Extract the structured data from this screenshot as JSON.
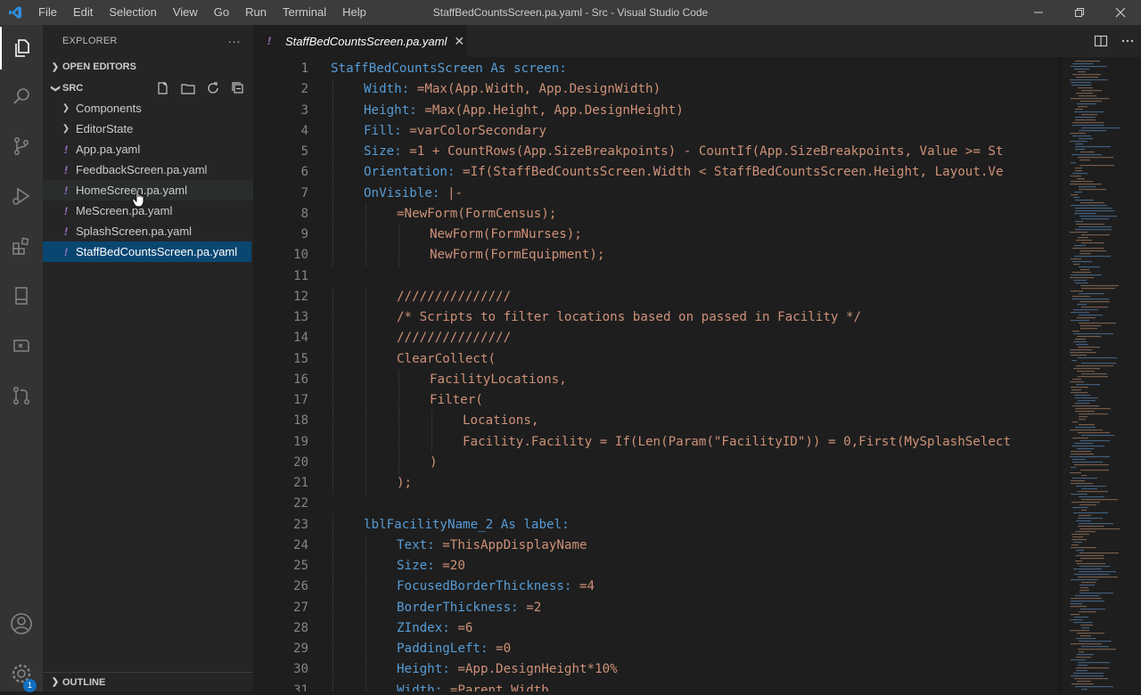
{
  "window": {
    "title": "StaffBedCountsScreen.pa.yaml - Src - Visual Studio Code",
    "menu": [
      "File",
      "Edit",
      "Selection",
      "View",
      "Go",
      "Run",
      "Terminal",
      "Help"
    ]
  },
  "activity_bar": {
    "items": [
      "files-icon",
      "search-icon",
      "source-control-icon",
      "run-debug-icon",
      "extensions-icon",
      "book-icon",
      "remote-icon",
      "pull-request-icon"
    ],
    "bottom": [
      "account-icon",
      "manage-gear-icon"
    ],
    "badge": "1"
  },
  "sidebar": {
    "title": "EXPLORER",
    "more": "···",
    "open_editors": "OPEN EDITORS",
    "folder": "SRC",
    "items": [
      {
        "type": "folder",
        "label": "Components"
      },
      {
        "type": "folder",
        "label": "EditorState"
      },
      {
        "type": "file",
        "label": "App.pa.yaml"
      },
      {
        "type": "file",
        "label": "FeedbackScreen.pa.yaml"
      },
      {
        "type": "file",
        "label": "HomeScreen.pa.yaml"
      },
      {
        "type": "file",
        "label": "MeScreen.pa.yaml"
      },
      {
        "type": "file",
        "label": "SplashScreen.pa.yaml"
      },
      {
        "type": "file",
        "label": "StaffBedCountsScreen.pa.yaml"
      }
    ],
    "outline": "OUTLINE",
    "yaml_glyph": "!"
  },
  "tab": {
    "name": "StaffBedCountsScreen.pa.yaml",
    "close": "✕"
  },
  "code": {
    "line_numbers": [
      "1",
      "2",
      "3",
      "4",
      "5",
      "6",
      "7",
      "8",
      "9",
      "10",
      "11",
      "12",
      "13",
      "14",
      "15",
      "16",
      "17",
      "18",
      "19",
      "20",
      "21",
      "22",
      "23",
      "24",
      "25",
      "26",
      "27",
      "28",
      "29",
      "30",
      "31"
    ],
    "lines": [
      {
        "indent": 0,
        "key": "StaffBedCountsScreen As screen:",
        "value": ""
      },
      {
        "indent": 1,
        "key": "Width:",
        "value": " =Max(App.Width, App.DesignWidth)"
      },
      {
        "indent": 1,
        "key": "Height:",
        "value": " =Max(App.Height, App.DesignHeight)"
      },
      {
        "indent": 1,
        "key": "Fill:",
        "value": " =varColorSecondary"
      },
      {
        "indent": 1,
        "key": "Size:",
        "value": " =1 + CountRows(App.SizeBreakpoints) - CountIf(App.SizeBreakpoints, Value >= St"
      },
      {
        "indent": 1,
        "key": "Orientation:",
        "value": " =If(StaffBedCountsScreen.Width < StaffBedCountsScreen.Height, Layout.Ve"
      },
      {
        "indent": 1,
        "key": "OnVisible:",
        "value": " |-"
      },
      {
        "indent": 2,
        "key": "",
        "value": "=NewForm(FormCensus);"
      },
      {
        "indent": 3,
        "key": "",
        "value": "NewForm(FormNurses);"
      },
      {
        "indent": 3,
        "key": "",
        "value": "NewForm(FormEquipment);"
      },
      {
        "indent": 0,
        "key": "",
        "value": ""
      },
      {
        "indent": 2,
        "key": "",
        "value": "///////////////"
      },
      {
        "indent": 2,
        "key": "",
        "value": "/* Scripts to filter locations based on passed in Facility */"
      },
      {
        "indent": 2,
        "key": "",
        "value": "///////////////"
      },
      {
        "indent": 2,
        "key": "",
        "value": "ClearCollect("
      },
      {
        "indent": 3,
        "key": "",
        "value": "FacilityLocations,"
      },
      {
        "indent": 3,
        "key": "",
        "value": "Filter("
      },
      {
        "indent": 4,
        "key": "",
        "value": "Locations,"
      },
      {
        "indent": 4,
        "key": "",
        "value": "Facility.Facility = If(Len(Param(\"FacilityID\")) = 0,First(MySplashSelect"
      },
      {
        "indent": 3,
        "key": "",
        "value": ")"
      },
      {
        "indent": 2,
        "key": "",
        "value": ");"
      },
      {
        "indent": 0,
        "key": "",
        "value": ""
      },
      {
        "indent": 1,
        "key": "lblFacilityName_2 As label:",
        "value": ""
      },
      {
        "indent": 2,
        "key": "Text:",
        "value": " =ThisAppDisplayName"
      },
      {
        "indent": 2,
        "key": "Size:",
        "value": " =20"
      },
      {
        "indent": 2,
        "key": "FocusedBorderThickness:",
        "value": " =4"
      },
      {
        "indent": 2,
        "key": "BorderThickness:",
        "value": " =2"
      },
      {
        "indent": 2,
        "key": "ZIndex:",
        "value": " =6"
      },
      {
        "indent": 2,
        "key": "PaddingLeft:",
        "value": " =0"
      },
      {
        "indent": 2,
        "key": "Height:",
        "value": " =App.DesignHeight*10%"
      },
      {
        "indent": 2,
        "key": "Width:",
        "value": " =Parent.Width"
      }
    ]
  },
  "colors": {
    "keyword": "#569cd6",
    "string": "#ce9178",
    "selection": "#094771",
    "titlebar": "#3c3c3c",
    "activitybar": "#333333",
    "sidebar": "#252526",
    "editor": "#1e1e1e"
  }
}
